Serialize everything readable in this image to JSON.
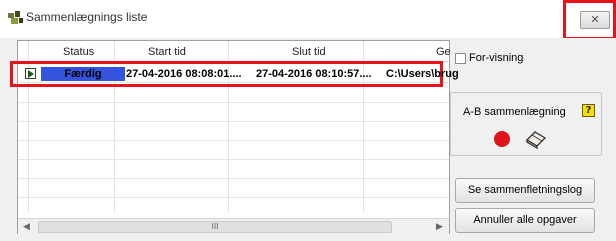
{
  "window": {
    "title": "Sammenlægnings liste",
    "close_label": "✕"
  },
  "table": {
    "columns": [
      "Status",
      "Start tid",
      "Slut tid",
      "Ge"
    ],
    "rows": [
      {
        "status": "Færdig",
        "start": "27-04-2016 08:08:01....",
        "end": "27-04-2016 08:10:57....",
        "path": "C:\\Users\\brug"
      }
    ],
    "scroll_grip": "III"
  },
  "preview": {
    "label": "For-visning",
    "checked": false
  },
  "ab_group": {
    "label": "A-B sammenlægning",
    "help": "?"
  },
  "buttons": {
    "log": "Se sammenfletningslog",
    "cancel_all": "Annuller alle opgaver"
  },
  "colors": {
    "status_fill": "#3355dd",
    "highlight": "#e8121a",
    "record": "#e0141a"
  }
}
